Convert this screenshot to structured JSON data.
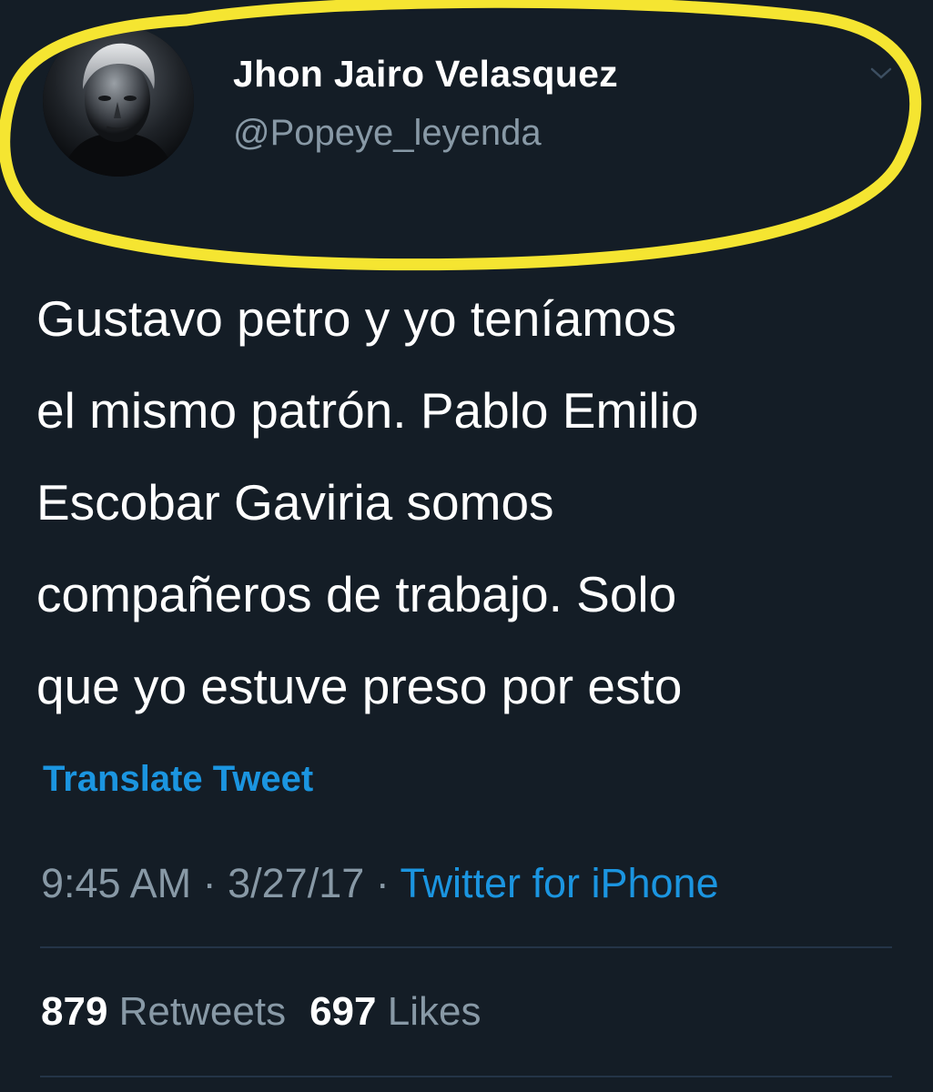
{
  "profile": {
    "display_name": "Jhon Jairo Velasquez",
    "handle": "@Popeye_leyenda",
    "avatar_icon": "profile-photo"
  },
  "tweet": {
    "lines": [
      "Gustavo petro y yo teníamos",
      "el mismo patrón. Pablo Emilio",
      "Escobar Gaviria somos",
      "compañeros de trabajo. Solo",
      "que yo estuve preso por esto"
    ],
    "translate_label": "Translate Tweet",
    "time": "9:45 AM",
    "date": "3/27/17",
    "separator": " · ",
    "source": "Twitter for iPhone"
  },
  "stats": {
    "retweets_count": "879",
    "retweets_label": "Retweets",
    "likes_count": "697",
    "likes_label": "Likes"
  },
  "colors": {
    "background": "#141d26",
    "link_blue": "#1b95e0",
    "muted_gray": "#8899a6",
    "highlight_yellow": "#f5e531"
  },
  "icons": {
    "caret": "chevron-down-icon"
  }
}
